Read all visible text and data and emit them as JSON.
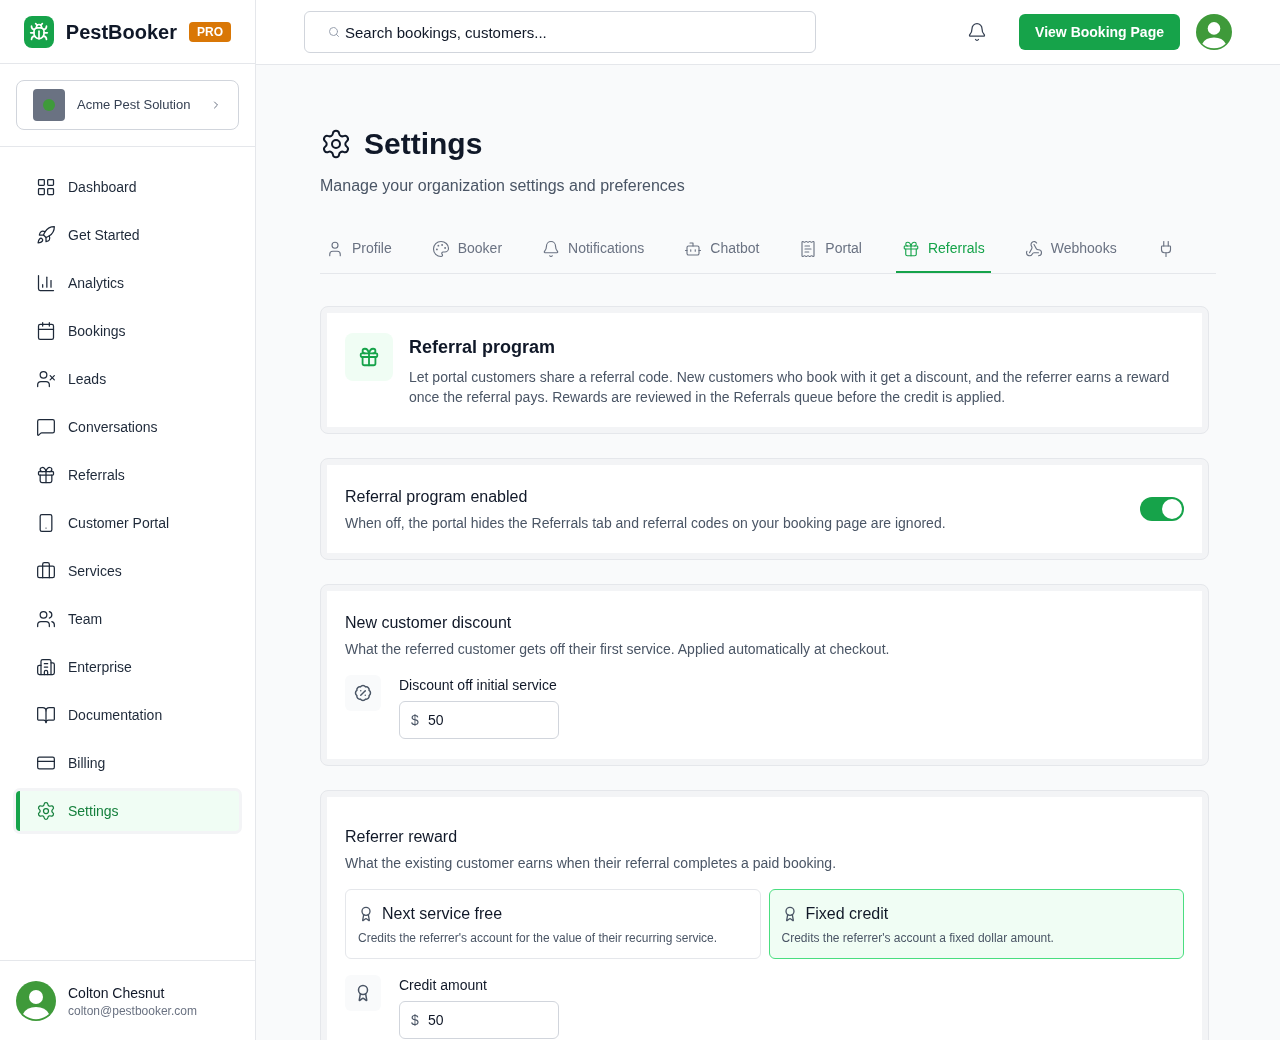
{
  "brand": {
    "name": "PestBooker",
    "badge": "PRO"
  },
  "org": {
    "name": "Acme Pest Solution"
  },
  "sidebar": {
    "items": [
      {
        "label": "Dashboard",
        "selected": false
      },
      {
        "label": "Get Started",
        "selected": false
      },
      {
        "label": "Analytics",
        "selected": false
      },
      {
        "label": "Bookings",
        "selected": false
      },
      {
        "label": "Leads",
        "selected": false
      },
      {
        "label": "Conversations",
        "selected": false
      },
      {
        "label": "Referrals",
        "selected": false
      },
      {
        "label": "Customer Portal",
        "selected": false
      },
      {
        "label": "Services",
        "selected": false
      },
      {
        "label": "Team",
        "selected": false
      },
      {
        "label": "Enterprise",
        "selected": false
      },
      {
        "label": "Documentation",
        "selected": false
      },
      {
        "label": "Billing",
        "selected": false
      },
      {
        "label": "Settings",
        "selected": true
      }
    ]
  },
  "user": {
    "name": "Colton Chesnut",
    "email": "colton@pestbooker.com"
  },
  "search": {
    "placeholder": "Search bookings, customers..."
  },
  "header": {
    "button": "View Booking Page"
  },
  "page": {
    "title": "Settings",
    "subtitle": "Manage your organization settings and preferences"
  },
  "tabs": [
    {
      "label": "Profile",
      "selected": false
    },
    {
      "label": "Booker",
      "selected": false
    },
    {
      "label": "Notifications",
      "selected": false
    },
    {
      "label": "Chatbot",
      "selected": false
    },
    {
      "label": "Portal",
      "selected": false
    },
    {
      "label": "Referrals",
      "selected": true
    },
    {
      "label": "Webhooks",
      "selected": false
    },
    {
      "selected": false
    }
  ],
  "program": {
    "title": "Referral program",
    "description": "Let portal customers share a referral code. New customers who book with it get a discount, and the referrer earns a reward once the referral pays. Rewards are reviewed in the Referrals queue before the credit is applied."
  },
  "enabled": {
    "title": "Referral program enabled",
    "description": "When off, the portal hides the Referrals tab and referral codes on your booking page are ignored.",
    "on": true
  },
  "discount": {
    "title": "New customer discount",
    "description": "What the referred customer gets off their first service. Applied automatically at checkout.",
    "field_label": "Discount off initial service",
    "prefix": "$",
    "value": "50"
  },
  "reward": {
    "title": "Referrer reward",
    "description": "What the existing customer earns when their referral completes a paid booking.",
    "options": [
      {
        "title": "Next service free",
        "description": "Credits the referrer's account for the value of their recurring service.",
        "selected": false
      },
      {
        "title": "Fixed credit",
        "description": "Credits the referrer's account a fixed dollar amount.",
        "selected": true
      }
    ],
    "field_label": "Credit amount",
    "prefix": "$",
    "value": "50"
  }
}
